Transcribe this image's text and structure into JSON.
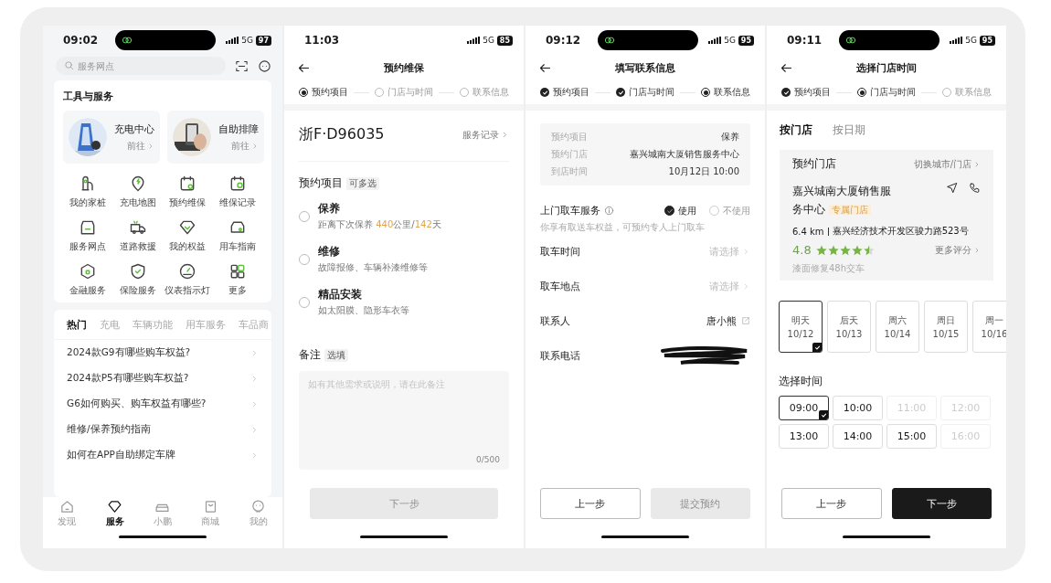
{
  "screens": [
    {
      "kind": "services",
      "status_bar": {
        "time": "09:02",
        "network": "5G",
        "battery": "97",
        "island": true
      },
      "search": {
        "placeholder": "服务网点"
      },
      "tools": {
        "title": "工具与服务",
        "cards": [
          {
            "title": "充电中心",
            "link": "前往"
          },
          {
            "title": "自助排障",
            "link": "前往"
          }
        ],
        "items": [
          {
            "label": "我的家桩"
          },
          {
            "label": "充电地图"
          },
          {
            "label": "预约维保"
          },
          {
            "label": "维保记录"
          },
          {
            "label": "服务网点"
          },
          {
            "label": "道路救援"
          },
          {
            "label": "我的权益"
          },
          {
            "label": "用车指南"
          },
          {
            "label": "金融服务"
          },
          {
            "label": "保险服务"
          },
          {
            "label": "仪表指示灯"
          },
          {
            "label": "更多"
          }
        ]
      },
      "topics": [
        {
          "label": "热门",
          "selected": true
        },
        {
          "label": "充电",
          "selected": false
        },
        {
          "label": "车辆功能",
          "selected": false
        },
        {
          "label": "用车服务",
          "selected": false
        },
        {
          "label": "车品商",
          "selected": false
        }
      ],
      "questions": [
        {
          "text": "2024款G9有哪些购车权益?"
        },
        {
          "text": "2024款P5有哪些购车权益?"
        },
        {
          "text": "G6如何购买、购车权益有哪些?"
        },
        {
          "text": "维修/保养预约指南"
        },
        {
          "text": "如何在APP自助绑定车牌"
        }
      ],
      "nav": [
        {
          "label": "发现",
          "selected": false
        },
        {
          "label": "服务",
          "selected": true
        },
        {
          "label": "小鹏",
          "selected": false
        },
        {
          "label": "商城",
          "selected": false
        },
        {
          "label": "我的",
          "selected": false
        }
      ]
    },
    {
      "kind": "items",
      "status_bar": {
        "time": "11:03",
        "network": "5G",
        "battery": "85"
      },
      "header": {
        "title": "预约维保"
      },
      "steps": [
        {
          "label": "预约项目",
          "done": false,
          "selected": true
        },
        {
          "label": "门店与时间",
          "done": false,
          "selected": false
        },
        {
          "label": "联系信息",
          "done": false,
          "selected": false
        }
      ],
      "vehicle": {
        "plate": "浙F·D96035",
        "link": "服务记录"
      },
      "section": {
        "title": "预约项目",
        "tag": "可多选"
      },
      "options": [
        {
          "title": "保养",
          "checked": false,
          "note": [
            {
              "text": "距离下次保养 ",
              "highlight": false
            },
            {
              "text": "440",
              "highlight": true
            },
            {
              "text": "公里/",
              "highlight": false
            },
            {
              "text": "142",
              "highlight": true
            },
            {
              "text": "天",
              "highlight": false
            }
          ]
        },
        {
          "title": "维修",
          "checked": false,
          "note": [
            {
              "text": "故障报修、车辆补漆维修等",
              "highlight": false
            }
          ]
        },
        {
          "title": "精品安装",
          "checked": false,
          "note": [
            {
              "text": "如太阳膜、隐形车衣等",
              "highlight": false
            }
          ]
        }
      ],
      "remark": {
        "title": "备注",
        "tag": "选填",
        "placeholder": "如有其他需求或说明，请在此备注",
        "counter": "0/500"
      },
      "buttons": [
        {
          "label": "下一步",
          "kind": "primary",
          "disabled": true
        }
      ]
    },
    {
      "kind": "contact",
      "status_bar": {
        "time": "09:12",
        "network": "5G",
        "battery": "95",
        "island": true
      },
      "header": {
        "title": "填写联系信息"
      },
      "steps": [
        {
          "label": "预约项目",
          "done": true,
          "selected": false
        },
        {
          "label": "门店与时间",
          "done": true,
          "selected": false
        },
        {
          "label": "联系信息",
          "done": false,
          "selected": true
        }
      ],
      "summary": [
        {
          "label": "预约项目",
          "value": "保养"
        },
        {
          "label": "预约门店",
          "value": "嘉兴城南大厦销售服务中心"
        },
        {
          "label": "到店时间",
          "value": "10月12日 10:00"
        }
      ],
      "pickup": {
        "title": "上门取车服务",
        "options": [
          {
            "label": "使用",
            "selected": true
          },
          {
            "label": "不使用",
            "selected": false
          }
        ],
        "note": "你享有取送车权益，可预约专人上门取车"
      },
      "fields": [
        {
          "label": "取车时间",
          "kind": "select",
          "placeholder": "请选择"
        },
        {
          "label": "取车地点",
          "kind": "select",
          "placeholder": "请选择"
        },
        {
          "label": "联系人",
          "kind": "edit",
          "value": "唐小熊"
        },
        {
          "label": "联系电话",
          "kind": "redacted"
        }
      ],
      "buttons": [
        {
          "label": "上一步",
          "kind": "secondary",
          "disabled": false
        },
        {
          "label": "提交预约",
          "kind": "primary",
          "disabled": true
        }
      ]
    },
    {
      "kind": "store_time",
      "status_bar": {
        "time": "09:11",
        "network": "5G",
        "battery": "95",
        "island": true
      },
      "header": {
        "title": "选择门店时间"
      },
      "steps": [
        {
          "label": "预约项目",
          "done": true,
          "selected": false
        },
        {
          "label": "门店与时间",
          "done": false,
          "selected": true
        },
        {
          "label": "联系信息",
          "done": false,
          "selected": false
        }
      ],
      "mode_tabs": [
        {
          "label": "按门店",
          "selected": true
        },
        {
          "label": "按日期",
          "selected": false
        }
      ],
      "store": {
        "heading": "预约门店",
        "switch_link": "切换城市/门店",
        "name": "嘉兴城南大厦销售服务中心",
        "tag": "专属门店",
        "distance": "6.4 km",
        "address": "嘉兴经济技术开发区骏力路523号",
        "rating": "4.8",
        "stars": 4.5,
        "more_link": "更多评分",
        "note": "漆面修复48h交车"
      },
      "dates": [
        {
          "day": "明天",
          "date": "10/12",
          "selected": true
        },
        {
          "day": "后天",
          "date": "10/13",
          "selected": false
        },
        {
          "day": "周六",
          "date": "10/14",
          "selected": false
        },
        {
          "day": "周日",
          "date": "10/15",
          "selected": false
        },
        {
          "day": "周一",
          "date": "10/16",
          "selected": false
        }
      ],
      "time_title": "选择时间",
      "slots": [
        {
          "time": "09:00",
          "selected": true,
          "disabled": false
        },
        {
          "time": "10:00",
          "selected": false,
          "disabled": false
        },
        {
          "time": "11:00",
          "selected": false,
          "disabled": true
        },
        {
          "time": "12:00",
          "selected": false,
          "disabled": true
        },
        {
          "time": "13:00",
          "selected": false,
          "disabled": false
        },
        {
          "time": "14:00",
          "selected": false,
          "disabled": false
        },
        {
          "time": "15:00",
          "selected": false,
          "disabled": false
        },
        {
          "time": "16:00",
          "selected": false,
          "disabled": true
        }
      ],
      "buttons": [
        {
          "label": "上一步",
          "kind": "secondary",
          "disabled": false
        },
        {
          "label": "下一步",
          "kind": "primary",
          "disabled": false
        }
      ]
    }
  ]
}
